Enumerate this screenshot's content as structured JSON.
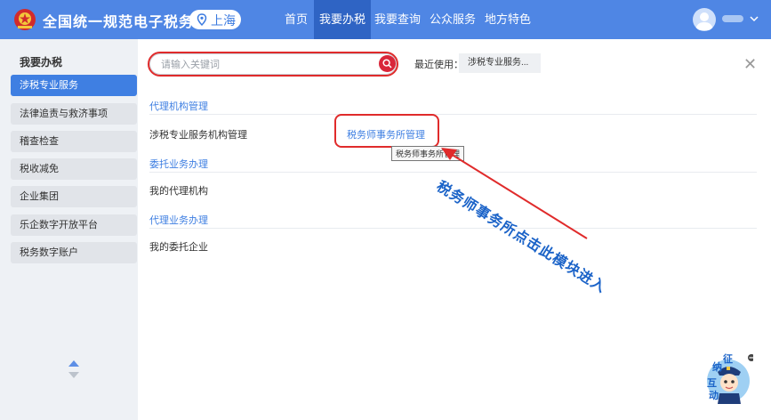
{
  "header": {
    "title": "全国统一规范电子税务局",
    "region": "上海",
    "nav": [
      {
        "label": "首页",
        "active": false
      },
      {
        "label": "我要办税",
        "active": true
      },
      {
        "label": "我要查询",
        "active": false
      },
      {
        "label": "公众服务",
        "active": false
      },
      {
        "label": "地方特色",
        "active": false
      }
    ],
    "user_icon": "user-avatar-icon",
    "accent": "#4f86e4"
  },
  "sidebar": {
    "heading": "我要办税",
    "items": [
      {
        "label": "涉税专业服务",
        "active": true
      },
      {
        "label": "法律追责与救济事项",
        "active": false
      },
      {
        "label": "稽查检查",
        "active": false
      },
      {
        "label": "税收减免",
        "active": false
      },
      {
        "label": "企业集团",
        "active": false
      },
      {
        "label": "乐企数字开放平台",
        "active": false
      },
      {
        "label": "税务数字账户",
        "active": false
      }
    ]
  },
  "search": {
    "placeholder": "请输入关键词",
    "recent_label": "最近使用：",
    "recent_item": "涉税专业服务..."
  },
  "sections": [
    {
      "title": "代理机构管理",
      "row": "涉税专业服务机构管理",
      "link": "税务师事务所管理"
    },
    {
      "title": "委托业务办理",
      "row": "我的代理机构"
    },
    {
      "title": "代理业务办理",
      "row": "我的委托企业"
    }
  ],
  "tooltip": "税务师事务所管理",
  "annotation": "税务师事务所点击此模块进入",
  "helper": {
    "chars": [
      "纳",
      "征",
      "互",
      "动"
    ]
  },
  "colors": {
    "annotation_red": "#e02b2b",
    "link_blue": "#3f7fe2"
  }
}
